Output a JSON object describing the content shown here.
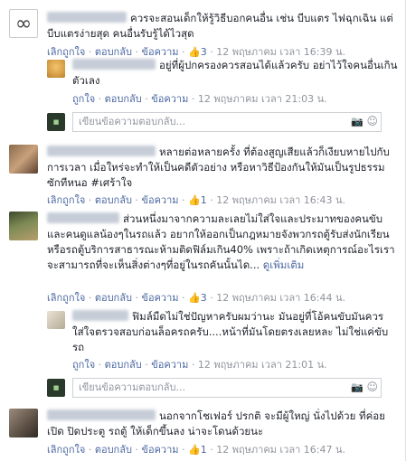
{
  "comments": [
    {
      "text": "ควรจะสอนเด็กให้รู้วิธีบอกคนอื่น เช่น บีบแตร ไฟฉุกเฉิน แต่บีบแตรง่ายสุด คนอื่นรับรู้ได้ไวสุด",
      "meta": {
        "unlike": "เลิกถูกใจ",
        "reply": "ตอบกลับ",
        "message": "ข้อความ",
        "likes": "3",
        "time": "12 พฤษภาคม เวลา 16:39 น."
      },
      "replies": [
        {
          "text": "อยู่ที่ผู้ปกครองควรสอนได้แล้วครับ อย่าไว้ใจคนอื่นเกินตัวเลง",
          "meta": {
            "like": "ถูกใจ",
            "reply": "ตอบกลับ",
            "message": "ข้อความ",
            "time": "12 พฤษภาคม เวลา 21:03 น."
          }
        }
      ],
      "write_placeholder": "เขียนข้อความตอบกลับ..."
    },
    {
      "text": "หลายต่อหลายครั้ง ที่ต้องสูญเสียแล้วก็เงียบหายไปกับการเวลา เมื่อใหร่จะทำให้เป็นคดีตัวอย่าง หรือหาวิธีป้องกันให้มันเป็นรูปธรรม ซักทีหนอ #เศร้าใจ",
      "meta": {
        "unlike": "เลิกถูกใจ",
        "reply": "ตอบกลับ",
        "message": "ข้อความ",
        "likes": "1",
        "time": "12 พฤษภาคม เวลา 16:43 น."
      }
    },
    {
      "text": "ส่วนหนึ่งมาจากความละเลยไม่ใส่ใจและประมาทของคนขับและคนดูแลน้องๆในรถแล้ว อยากให้ออกเป็นกฎหมายจังพวกรถตู้รับส่งนักเรียนหรือรถตู้บริการสาธารณะห้ามติดฟิล์มเกิน40% เพราะถ้าเกิดเหตุการณ์อะไรเราจะสามารถที่จะเห็นสิ่งต่างๆที่อยู่ในรถคันนั้นได...",
      "more": "ดูเพิ่มเติม",
      "meta": {
        "unlike": "เลิกถูกใจ",
        "reply": "ตอบกลับ",
        "message": "ข้อความ",
        "likes": "3",
        "time": "12 พฤษภาคม เวลา 16:44 น."
      },
      "replies": [
        {
          "text": "ฟิมล์มืดไม่ใช่ปัญหาครับผมว่านะ มันอยู่ที่โอ้คนขับมันควรใส่ใจตรวจสอบก่อนล็อครถครับ....หน้าที่มันโดยตรงเลยหละ ไม่ใช่แค่ขับรถ",
          "meta": {
            "like": "ถูกใจ",
            "reply": "ตอบกลับ",
            "message": "ข้อความ",
            "time": "12 พฤษภาคม เวลา 21:01 น."
          }
        }
      ],
      "write_placeholder": "เขียนข้อความตอบกลับ..."
    },
    {
      "text": "นอกจากโชเฟอร์ ปรกติ จะมีผู้ใหญ่ นั่งไปด้วย ที่ค่อยเปิด ปิดประตู รถตู้ ให้เด็กขึ้นลง น่าจะโดนด้วยนะ",
      "meta": {
        "unlike": "เลิกถูกใจ",
        "reply": "ตอบกลับ",
        "message": "ข้อความ",
        "likes": "1",
        "time": "12 พฤษภาคม เวลา 16:47 น."
      }
    }
  ]
}
